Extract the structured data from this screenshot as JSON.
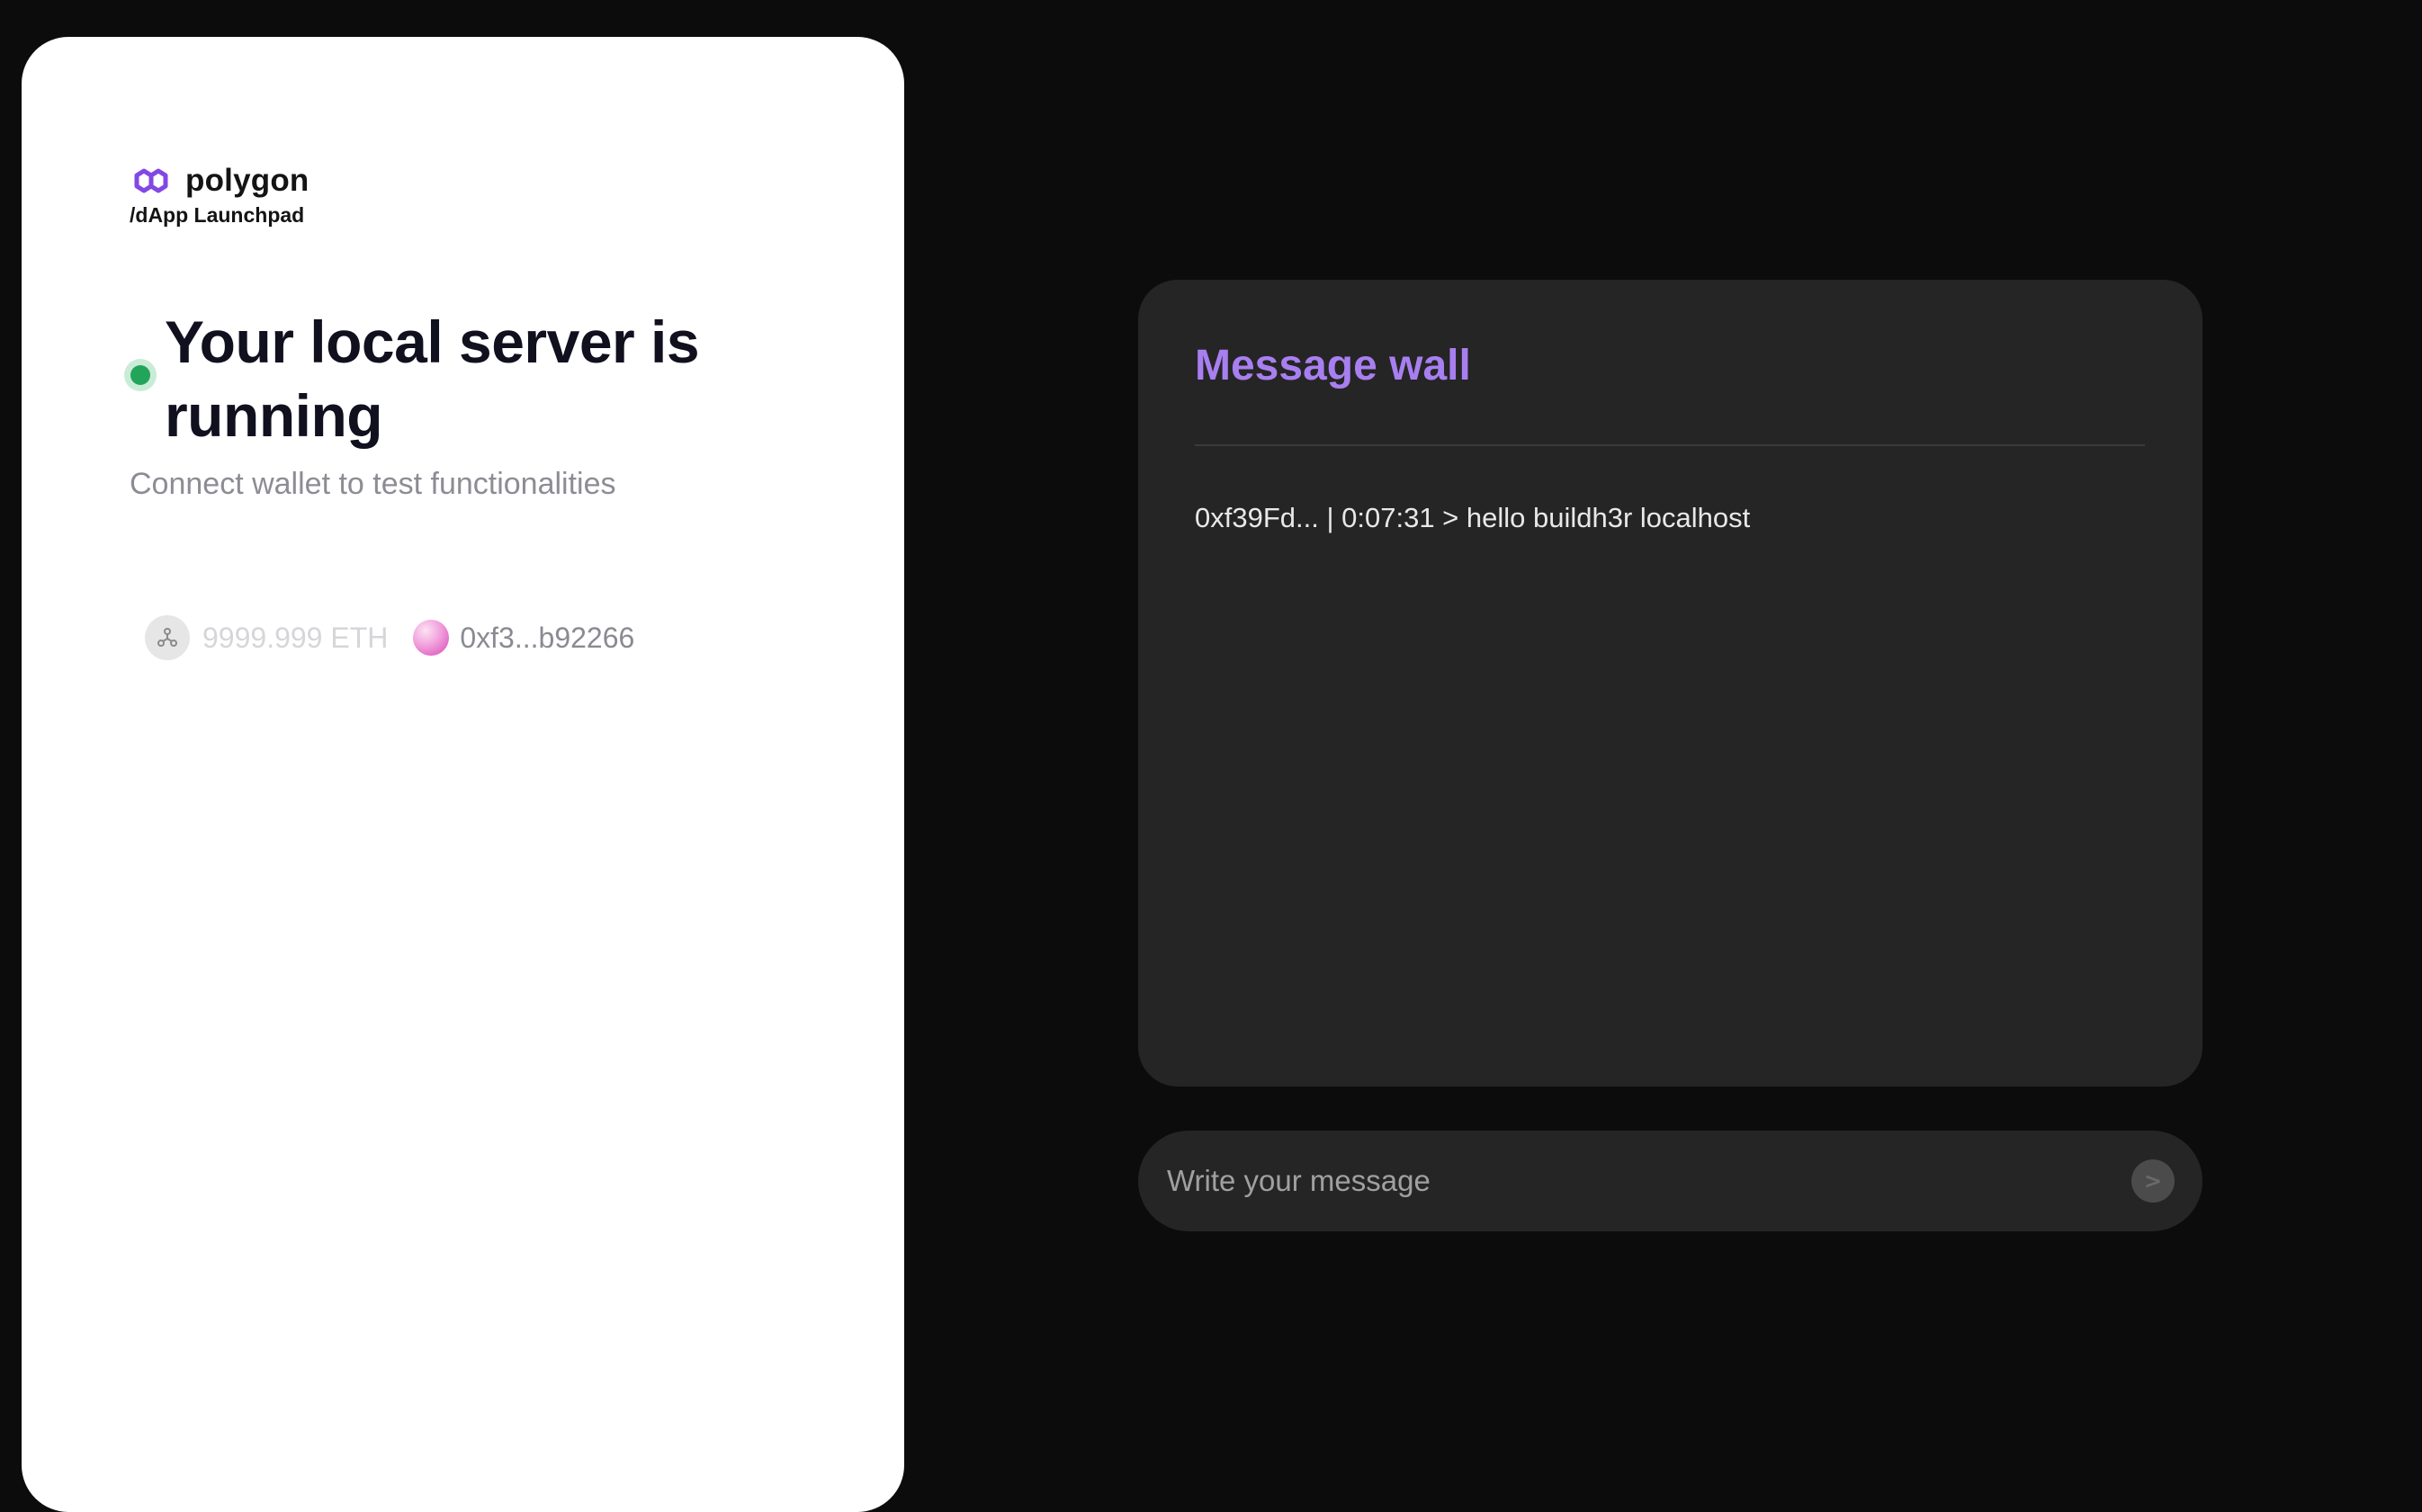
{
  "brand": {
    "name": "polygon",
    "subtitle": "/dApp Launchpad",
    "logo_icon": "polygon-logo-icon",
    "accent_color": "#8247e5"
  },
  "status": {
    "title": "Your local server is running",
    "subtitle": "Connect wallet to test functionalities",
    "indicator_color": "#22a55b"
  },
  "wallet": {
    "network_icon": "network-icon",
    "balance": "9999.999 ETH",
    "avatar_icon": "wallet-avatar-icon",
    "address": "0xf3...b92266"
  },
  "message_wall": {
    "title": "Message wall",
    "title_color": "#a87ff0",
    "messages": [
      {
        "text": "0xf39Fd... | 0:07:31 > hello buildh3r localhost"
      }
    ]
  },
  "composer": {
    "placeholder": "Write your message",
    "value": "",
    "send_icon": "send-arrow-icon",
    "send_label": ">"
  }
}
